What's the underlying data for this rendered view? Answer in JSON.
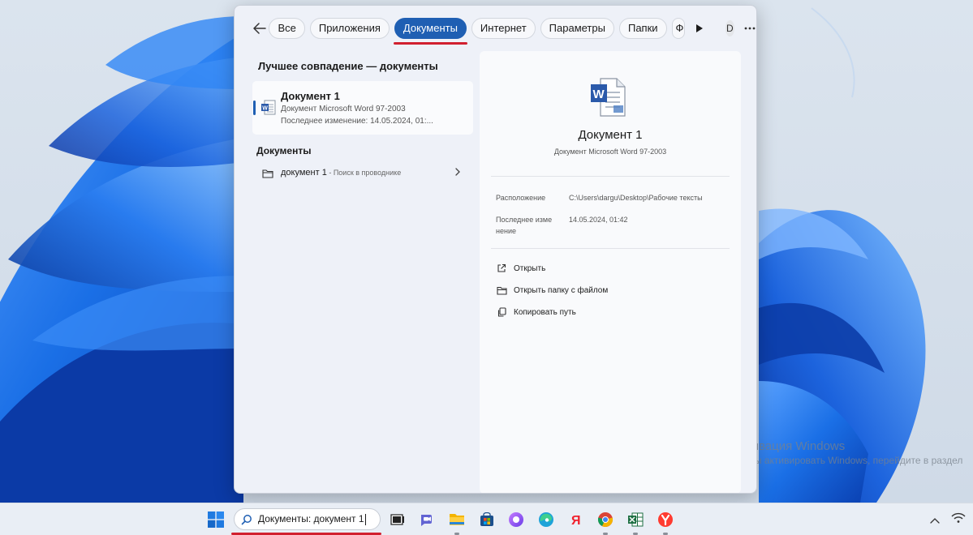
{
  "search_window": {
    "tabs": [
      {
        "label": "Все",
        "active": false
      },
      {
        "label": "Приложения",
        "active": false
      },
      {
        "label": "Документы",
        "active": true
      },
      {
        "label": "Интернет",
        "active": false
      },
      {
        "label": "Параметры",
        "active": false
      },
      {
        "label": "Папки",
        "active": false
      },
      {
        "label": "Ф",
        "active": false
      }
    ],
    "avatar_letter": "D",
    "best_match": {
      "heading": "Лучшее совпадение — документы",
      "title": "Документ 1",
      "type": "Документ Microsoft Word 97-2003",
      "modified": "Последнее изменение: 14.05.2024, 01:..."
    },
    "documents_section": {
      "heading": "Документы",
      "item_name": "документ 1",
      "item_hint": " - Поиск в проводнике"
    },
    "preview": {
      "title": "Документ 1",
      "subtitle": "Документ Microsoft Word 97-2003",
      "location_label": "Расположение",
      "location_value": "C:\\Users\\dargu\\Desktop\\Рабочие тексты",
      "modified_label_line1": "Последнее изме",
      "modified_label_line2": "нение",
      "modified_value": "14.05.2024, 01:42",
      "actions": [
        {
          "label": "Открыть",
          "icon": "open-external-icon"
        },
        {
          "label": "Открыть папку с файлом",
          "icon": "folder-icon"
        },
        {
          "label": "Копировать путь",
          "icon": "copy-icon"
        }
      ]
    }
  },
  "watermark": {
    "title": "Активация Windows",
    "subtitle": "Чтобы активировать Windows, перейдите в раздел"
  },
  "taskbar": {
    "search_text": "Документы: документ 1",
    "apps": [
      "task-view-icon",
      "teams-chat-icon",
      "file-explorer-icon",
      "microsoft-store-icon",
      "alice-assistant-icon",
      "edge-browser-icon",
      "yandex-icon",
      "chrome-icon",
      "excel-icon",
      "yandex-browser-icon"
    ]
  },
  "colors": {
    "accent": "#1f5fb3",
    "annotation_red": "#d1202f",
    "wallpaper_blue": "#1a6fe6"
  }
}
